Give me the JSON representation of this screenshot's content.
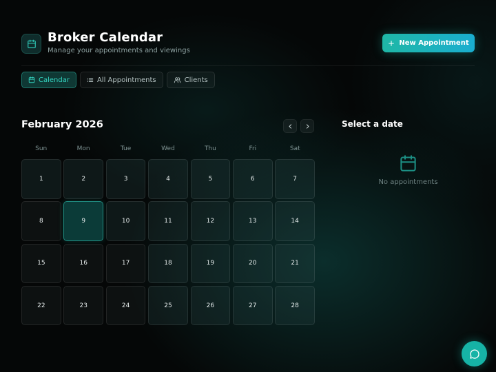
{
  "header": {
    "title": "Broker Calendar",
    "subtitle": "Manage your appointments and viewings",
    "new_button_label": "New Appointment"
  },
  "tabs": [
    {
      "label": "Calendar",
      "icon": "calendar-icon",
      "active": true
    },
    {
      "label": "All Appointments",
      "icon": "list-icon",
      "active": false
    },
    {
      "label": "Clients",
      "icon": "users-icon",
      "active": false
    }
  ],
  "calendar": {
    "month_label": "February 2026",
    "weekdays": [
      "Sun",
      "Mon",
      "Tue",
      "Wed",
      "Thu",
      "Fri",
      "Sat"
    ],
    "days": [
      "1",
      "2",
      "3",
      "4",
      "5",
      "6",
      "7",
      "8",
      "9",
      "10",
      "11",
      "12",
      "13",
      "14",
      "15",
      "16",
      "17",
      "18",
      "19",
      "20",
      "21",
      "22",
      "23",
      "24",
      "25",
      "26",
      "27",
      "28"
    ],
    "today": "9"
  },
  "side_panel": {
    "title": "Select a date",
    "empty_text": "No appointments"
  },
  "colors": {
    "accent": "#1fb7a6",
    "accent_text": "#34d4c0",
    "background": "#050707"
  }
}
